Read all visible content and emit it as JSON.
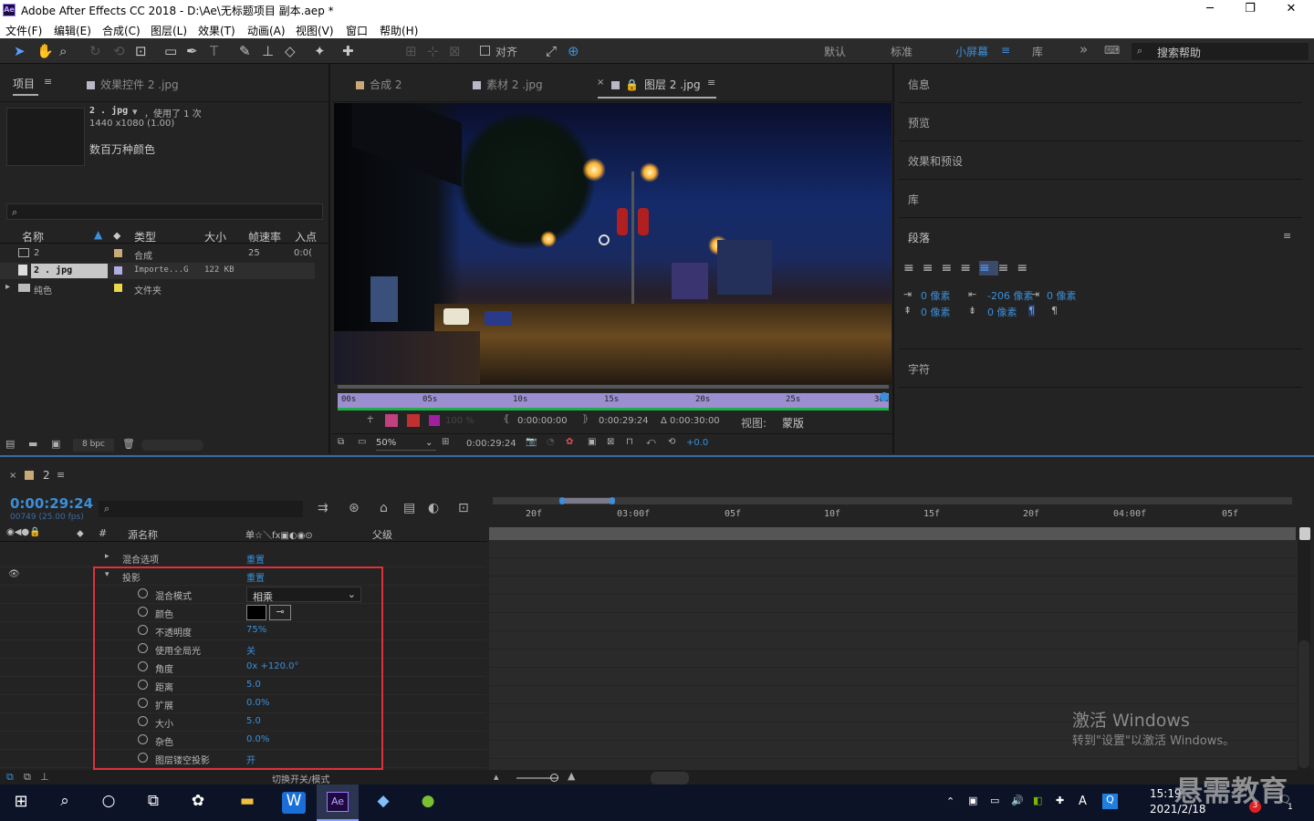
{
  "window": {
    "title": "Adobe After Effects CC 2018 - D:\\Ae\\无标题项目 副本.aep *",
    "minimize": "─",
    "maximize": "❐",
    "close": "✕"
  },
  "menu": [
    "文件(F)",
    "编辑(E)",
    "合成(C)",
    "图层(L)",
    "效果(T)",
    "动画(A)",
    "视图(V)",
    "窗口",
    "帮助(H)"
  ],
  "toolbar": {
    "align_label": "对齐",
    "workspaces": [
      "默认",
      "标准",
      "小屏幕",
      "库"
    ],
    "active_workspace": "小屏幕",
    "more": "»",
    "search_placeholder": "搜索帮助"
  },
  "project": {
    "tab": "项目",
    "fx_tab": "效果控件 2 .jpg",
    "item_name": "2 . jpg",
    "used": "，使用了 1 次",
    "dims": "1440 x1080 (1.00)",
    "color": "数百万种颜色",
    "search_placeholder": "",
    "columns": [
      "名称",
      "类型",
      "大小",
      "帧速率",
      "入点"
    ],
    "rows": [
      {
        "name": "2",
        "type": "合成",
        "size": "",
        "fps": "25",
        "in": "0:0("
      },
      {
        "name": "2 . jpg",
        "type": "Importe...G",
        "size": "122 KB",
        "fps": "",
        "in": ""
      },
      {
        "name": "纯色",
        "type": "文件夹",
        "size": "",
        "fps": "",
        "in": ""
      }
    ],
    "bpc": "8 bpc"
  },
  "viewer": {
    "tabs": [
      "合成 2",
      "素材 2 .jpg",
      "图层 2 .jpg"
    ],
    "active_tab": "图层 2 .jpg",
    "ruler": [
      "00s",
      "05s",
      "10s",
      "15s",
      "20s",
      "25s",
      "30s"
    ],
    "opacity": "100 %",
    "in_time": "0:00:00:00",
    "out_time": "0:00:29:24",
    "duration": "Δ 0:00:30:00",
    "view_label": "视图:",
    "view_value": "蒙版",
    "zoom": "50%",
    "current_time": "0:00:29:24",
    "exposure": "+0.0"
  },
  "right_panel": {
    "items": [
      "信息",
      "预览",
      "效果和预设",
      "库"
    ],
    "paragraph": "段落",
    "character": "字符",
    "indent1": "0 像素",
    "indent2": "-206 像素",
    "indent3": "0 像素",
    "space1": "0 像素",
    "space2": "0 像素"
  },
  "timeline": {
    "comp_tab": "2",
    "timecode": "0:00:29:24",
    "frame_info": "00749 (25.00 fps)",
    "search_placeholder": "",
    "col_source": "源名称",
    "col_parent": "父级",
    "col_switches": "单☆＼fx▣◐◉⊙",
    "ruler": [
      "20f",
      "03:00f",
      "05f",
      "10f",
      "15f",
      "20f",
      "04:00f",
      "05f"
    ],
    "toggle_label": "切换开关/模式",
    "blend_options": {
      "label": "混合选项",
      "value": "重置"
    },
    "drop_shadow": {
      "label": "投影",
      "value": "重置",
      "props": [
        {
          "label": "混合模式",
          "value": "相乘"
        },
        {
          "label": "颜色",
          "value": ""
        },
        {
          "label": "不透明度",
          "value": "75%"
        },
        {
          "label": "使用全局光",
          "value": "关"
        },
        {
          "label": "角度",
          "value": "0x +120.0°"
        },
        {
          "label": "距离",
          "value": "5.0"
        },
        {
          "label": "扩展",
          "value": "0.0%"
        },
        {
          "label": "大小",
          "value": "5.0"
        },
        {
          "label": "杂色",
          "value": "0.0%"
        },
        {
          "label": "图层镂空投影",
          "value": "开"
        }
      ]
    }
  },
  "watermark": {
    "line1": "激活 Windows",
    "line2": "转到\"设置\"以激活 Windows。",
    "brand": "悬需教育"
  },
  "taskbar": {
    "time": "15:19",
    "date": "2021/2/18",
    "ime": "A",
    "badge": "3",
    "notif": "1"
  }
}
